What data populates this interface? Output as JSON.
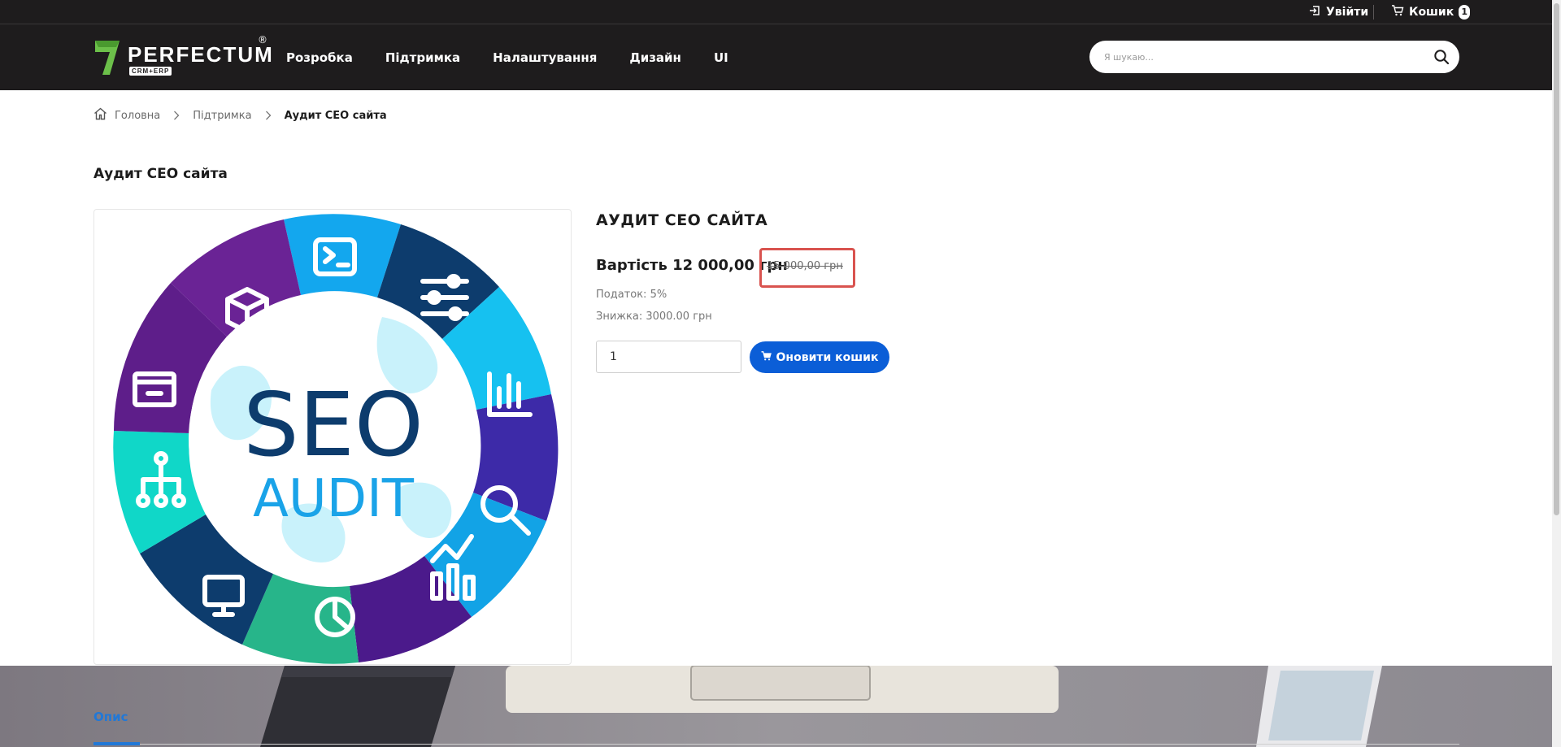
{
  "topbar": {
    "login_label": "Увійти",
    "cart_label": "Кошик",
    "cart_count": "1"
  },
  "header": {
    "logo_text": "PERFECTUM",
    "logo_sub": "CRM+ERP",
    "logo_reg": "®",
    "nav": [
      "Розробка",
      "Підтримка",
      "Налаштування",
      "Дизайн",
      "UI"
    ],
    "search_placeholder": "Я шукаю..."
  },
  "breadcrumb": {
    "home": "Головна",
    "parent": "Підтримка",
    "current": "Аудит СЕО сайта"
  },
  "page_title": "Аудит СЕО сайта",
  "product": {
    "image_text_1": "SEO",
    "image_text_2": "AUDIT",
    "title": "АУДИТ СЕО САЙТА",
    "price_label": "Вартість 12 000,00 грн",
    "old_price": "15 000,00 грн",
    "tax": "Податок: 5%",
    "discount": "Знижка: 3000.00 грн",
    "quantity": "1",
    "cart_button": "Оновити кошик"
  },
  "tabs": {
    "description": "Опис"
  },
  "colors": {
    "dark": "#1e1c1d",
    "accent_blue": "#0b5ed7",
    "highlight_red": "#d9534f",
    "tab_blue": "#2178d7"
  }
}
